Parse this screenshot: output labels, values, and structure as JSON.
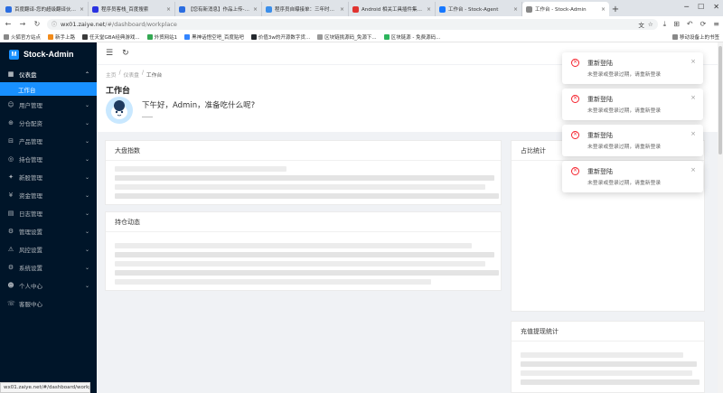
{
  "browser": {
    "tabs": [
      {
        "title": "百度翻译-您的超级翻译伙伴（文",
        "color": "#2b6de0"
      },
      {
        "title": "程序员客栈_百度搜索",
        "color": "#2932e1"
      },
      {
        "title": "【您有新消息】作品上传-程序员...",
        "color": "#2b6de0"
      },
      {
        "title": "程序员自曝接单：三年时间接了...",
        "color": "#3b8eea"
      },
      {
        "title": "Android 相关工具插件集成到...",
        "color": "#e0332f"
      },
      {
        "title": "工作台 - Stock-Agent",
        "color": "#1677ff"
      },
      {
        "title": "工作台 - Stock-Admin",
        "color": "#ffffff"
      }
    ],
    "url_host": "wx01.zaiye.net",
    "url_path": "/#/dashboard/workplace",
    "bookmarks": [
      "火狐官方站点",
      "新手上路",
      "任天堂GBA经典游戏...",
      "外贸网站1",
      "黑神话悟空吧_百度贴吧",
      "价值3w的开源数字货...",
      "区块链挑源码_免源下...",
      "区块链源 - 免费源码..."
    ],
    "bookmark_right": "移动设备上的书签",
    "status_url": "wx01.zaiye.net/#/dashboard/workplace"
  },
  "app": {
    "name": "Stock-Admin",
    "menu": {
      "group": "仪表盘",
      "active_sub": "工作台",
      "items": [
        {
          "label": "用户管理",
          "icon": "user-icon"
        },
        {
          "label": "分仓配资",
          "icon": "split-icon"
        },
        {
          "label": "产品管理",
          "icon": "product-icon"
        },
        {
          "label": "持仓管理",
          "icon": "position-icon"
        },
        {
          "label": "新股管理",
          "icon": "ipo-icon"
        },
        {
          "label": "资金管理",
          "icon": "fund-icon"
        },
        {
          "label": "日志管理",
          "icon": "log-icon"
        },
        {
          "label": "管理设置",
          "icon": "admin-icon"
        },
        {
          "label": "风控设置",
          "icon": "risk-icon"
        },
        {
          "label": "系统设置",
          "icon": "settings-icon"
        },
        {
          "label": "个人中心",
          "icon": "profile-icon"
        },
        {
          "label": "客服中心",
          "icon": "service-icon"
        }
      ]
    },
    "breadcrumb": [
      "主页",
      "仪表盘",
      "工作台"
    ],
    "page_title": "工作台",
    "greeting": "下午好，Admin，准备吃什么呢?",
    "cards": {
      "market": "大盘指数",
      "positions": "持仓动态",
      "ratio": "占比统计",
      "recharge": "充值提现统计"
    }
  },
  "notifications": [
    {
      "title": "重新登陆",
      "desc": "未登录或登录过期，请重新登录"
    },
    {
      "title": "重新登陆",
      "desc": "未登录或登录过期，请重新登录"
    },
    {
      "title": "重新登陆",
      "desc": "未登录或登录过期，请重新登录"
    },
    {
      "title": "重新登陆",
      "desc": "未登录或登录过期，请重新登录"
    }
  ]
}
